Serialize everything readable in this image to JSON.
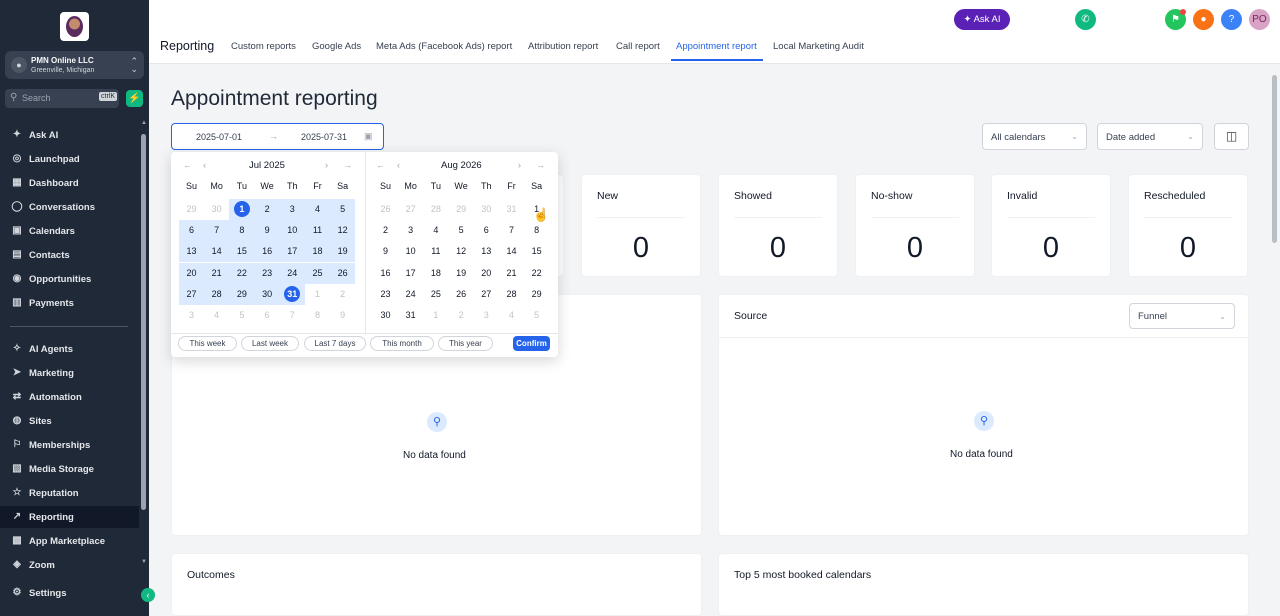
{
  "sidebar": {
    "account": {
      "name": "PMN Online LLC",
      "location": "Greenville, Michigan"
    },
    "search": {
      "placeholder": "Search",
      "shortcut": "ctrlK"
    },
    "items": [
      {
        "label": "Ask AI",
        "icon": "sparkle-icon"
      },
      {
        "label": "Launchpad",
        "icon": "rocket-icon"
      },
      {
        "label": "Dashboard",
        "icon": "grid-icon"
      },
      {
        "label": "Conversations",
        "icon": "chat-icon"
      },
      {
        "label": "Calendars",
        "icon": "calendar-icon"
      },
      {
        "label": "Contacts",
        "icon": "contacts-icon"
      },
      {
        "label": "Opportunities",
        "icon": "target-icon"
      },
      {
        "label": "Payments",
        "icon": "receipt-icon"
      },
      {
        "label": "AI Agents",
        "icon": "ai-agents-icon"
      },
      {
        "label": "Marketing",
        "icon": "send-icon"
      },
      {
        "label": "Automation",
        "icon": "automation-icon"
      },
      {
        "label": "Sites",
        "icon": "globe-icon"
      },
      {
        "label": "Memberships",
        "icon": "membership-icon"
      },
      {
        "label": "Media Storage",
        "icon": "image-icon"
      },
      {
        "label": "Reputation",
        "icon": "star-icon"
      },
      {
        "label": "Reporting",
        "icon": "chart-line-icon",
        "active": true
      },
      {
        "label": "App Marketplace",
        "icon": "apps-icon"
      },
      {
        "label": "Zoom",
        "icon": "zoom-icon"
      },
      {
        "label": "Settings",
        "icon": "gear-icon"
      }
    ]
  },
  "header": {
    "title": "Reporting",
    "tabs": [
      {
        "label": "Custom reports"
      },
      {
        "label": "Google Ads"
      },
      {
        "label": "Meta Ads (Facebook Ads) report"
      },
      {
        "label": "Attribution report"
      },
      {
        "label": "Call report"
      },
      {
        "label": "Appointment report",
        "active": true
      },
      {
        "label": "Local Marketing Audit"
      }
    ],
    "ask_ai_label": "Ask AI",
    "user_initials": "PO",
    "colors": {
      "phone": "#10b981",
      "ask_ai": "#5b21b6",
      "megaphone": "#22c55e",
      "bell": "#f97316",
      "help": "#3b82f6",
      "avatar": "#d8a3c4"
    }
  },
  "main": {
    "title": "Appointment reporting",
    "date_range": {
      "start": "2025-07-01",
      "end": "2025-07-31"
    },
    "calendars_select": "All calendars",
    "date_type_select": "Date added",
    "stats": [
      {
        "label": "New",
        "value": "0"
      },
      {
        "label": "Showed",
        "value": "0"
      },
      {
        "label": "No-show",
        "value": "0"
      },
      {
        "label": "Invalid",
        "value": "0"
      },
      {
        "label": "Rescheduled",
        "value": "0"
      }
    ],
    "left_panel": {
      "empty_text": "No data found"
    },
    "source_panel": {
      "title": "Source",
      "select": "Funnel",
      "empty_text": "No data found"
    },
    "outcomes_title": "Outcomes",
    "top_calendars_title": "Top 5 most booked calendars"
  },
  "calendar": {
    "weekdays": [
      "Su",
      "Mo",
      "Tu",
      "We",
      "Th",
      "Fr",
      "Sa"
    ],
    "left": {
      "month": "Jul 2025",
      "days": [
        [
          {
            "d": "29",
            "m": 1
          },
          {
            "d": "30",
            "m": 1
          },
          {
            "d": "1",
            "s": 1
          },
          {
            "d": "2"
          },
          {
            "d": "3"
          },
          {
            "d": "4"
          },
          {
            "d": "5"
          }
        ],
        [
          {
            "d": "6"
          },
          {
            "d": "7"
          },
          {
            "d": "8"
          },
          {
            "d": "9"
          },
          {
            "d": "10"
          },
          {
            "d": "11"
          },
          {
            "d": "12"
          }
        ],
        [
          {
            "d": "13"
          },
          {
            "d": "14"
          },
          {
            "d": "15"
          },
          {
            "d": "16"
          },
          {
            "d": "17"
          },
          {
            "d": "18"
          },
          {
            "d": "19"
          }
        ],
        [
          {
            "d": "20"
          },
          {
            "d": "21"
          },
          {
            "d": "22"
          },
          {
            "d": "23"
          },
          {
            "d": "24"
          },
          {
            "d": "25"
          },
          {
            "d": "26"
          }
        ],
        [
          {
            "d": "27"
          },
          {
            "d": "28"
          },
          {
            "d": "29"
          },
          {
            "d": "30"
          },
          {
            "d": "31",
            "s": 1
          },
          {
            "d": "1",
            "m": 1
          },
          {
            "d": "2",
            "m": 1
          }
        ],
        [
          {
            "d": "3",
            "m": 1
          },
          {
            "d": "4",
            "m": 1
          },
          {
            "d": "5",
            "m": 1
          },
          {
            "d": "6",
            "m": 1
          },
          {
            "d": "7",
            "m": 1
          },
          {
            "d": "8",
            "m": 1
          },
          {
            "d": "9",
            "m": 1
          }
        ]
      ]
    },
    "right": {
      "month": "Aug 2026",
      "days": [
        [
          {
            "d": "26",
            "m": 1
          },
          {
            "d": "27",
            "m": 1
          },
          {
            "d": "28",
            "m": 1
          },
          {
            "d": "29",
            "m": 1
          },
          {
            "d": "30",
            "m": 1
          },
          {
            "d": "31",
            "m": 1
          },
          {
            "d": "1"
          }
        ],
        [
          {
            "d": "2"
          },
          {
            "d": "3"
          },
          {
            "d": "4"
          },
          {
            "d": "5"
          },
          {
            "d": "6"
          },
          {
            "d": "7"
          },
          {
            "d": "8"
          }
        ],
        [
          {
            "d": "9"
          },
          {
            "d": "10"
          },
          {
            "d": "11"
          },
          {
            "d": "12"
          },
          {
            "d": "13"
          },
          {
            "d": "14"
          },
          {
            "d": "15"
          }
        ],
        [
          {
            "d": "16"
          },
          {
            "d": "17"
          },
          {
            "d": "18"
          },
          {
            "d": "19"
          },
          {
            "d": "20"
          },
          {
            "d": "21"
          },
          {
            "d": "22"
          }
        ],
        [
          {
            "d": "23"
          },
          {
            "d": "24"
          },
          {
            "d": "25"
          },
          {
            "d": "26"
          },
          {
            "d": "27"
          },
          {
            "d": "28"
          },
          {
            "d": "29"
          }
        ],
        [
          {
            "d": "30"
          },
          {
            "d": "31"
          },
          {
            "d": "1",
            "m": 1
          },
          {
            "d": "2",
            "m": 1
          },
          {
            "d": "3",
            "m": 1
          },
          {
            "d": "4",
            "m": 1
          },
          {
            "d": "5",
            "m": 1
          }
        ]
      ]
    },
    "quick_ranges": [
      {
        "label": "This week"
      },
      {
        "label": "Last week"
      },
      {
        "label": "Last 7 days"
      },
      {
        "label": "This month"
      },
      {
        "label": "This year"
      }
    ],
    "confirm_label": "Confirm",
    "accent_color": "#2563eb",
    "range_color": "#dbeafe"
  }
}
